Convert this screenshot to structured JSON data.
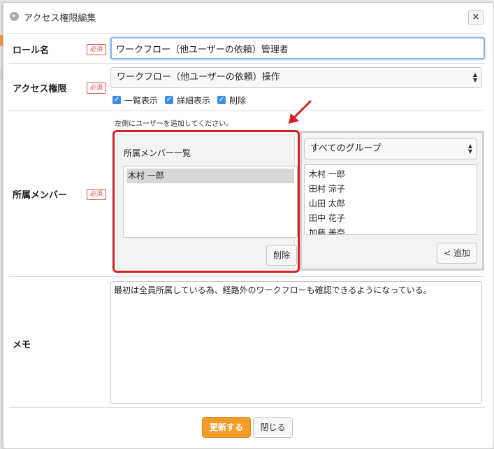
{
  "dialog": {
    "title": "アクセス権限編集",
    "close_icon": "×"
  },
  "role": {
    "label": "ロール名",
    "required": "必須",
    "value": "ワークフロー（他ユーザーの依頼）管理者"
  },
  "access": {
    "label": "アクセス権限",
    "required": "必須",
    "selected": "ワークフロー（他ユーザーの依頼）操作",
    "checkboxes": [
      {
        "label": "一覧表示",
        "checked": true
      },
      {
        "label": "詳細表示",
        "checked": true
      },
      {
        "label": "削除",
        "checked": true
      }
    ]
  },
  "members": {
    "label": "所属メンバー",
    "required": "必須",
    "hint": "左側にユーザーを追加してください。",
    "list_title": "所属メンバー一覧",
    "list": [
      "木村 一郎"
    ],
    "delete_label": "削除",
    "group_selected": "すべてのグループ",
    "group_users": [
      "木村 一郎",
      "田村 涼子",
      "山田 太郎",
      "田中 花子",
      "加藤 美奈"
    ],
    "add_label": "< 追加"
  },
  "memo": {
    "label": "メモ",
    "value": "最初は全員所属している為、経路外のワークフローも確認できるようになっている。"
  },
  "footer": {
    "update_label": "更新する",
    "close_label": "閉じる"
  },
  "colors": {
    "accent": "#f49b2c",
    "required": "#d9534f",
    "highlight": "#d42020",
    "checkbox": "#3b8ee0"
  }
}
